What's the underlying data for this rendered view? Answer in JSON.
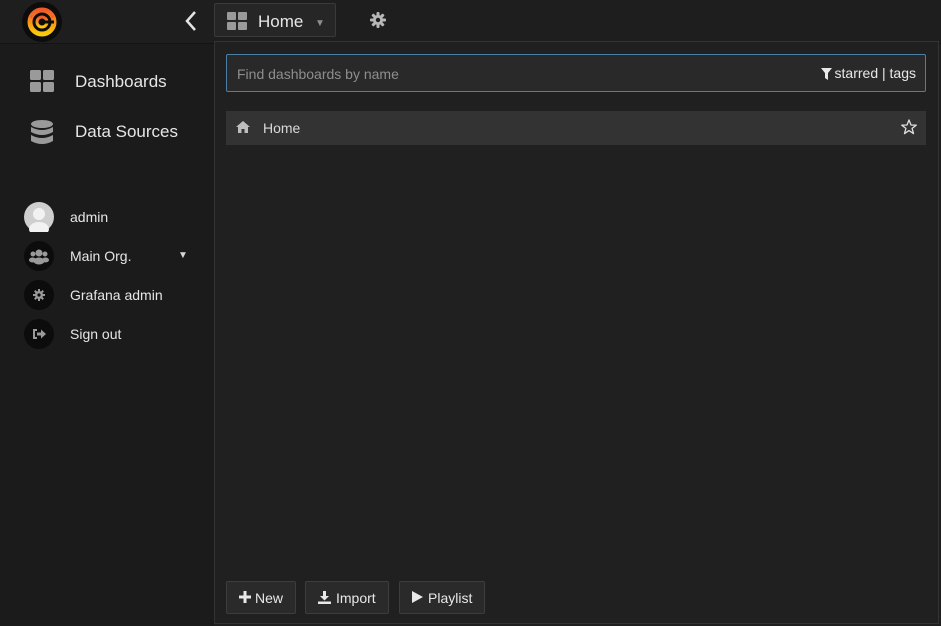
{
  "topbar": {
    "dashboard_title": "Home"
  },
  "icons": {
    "logo": "grafana-logo",
    "collapse": "chevron-left-icon",
    "dashboards": "grid-icon",
    "data_sources": "database-icon",
    "settings": "gear-icon",
    "home": "home-icon",
    "star": "star-icon",
    "filter": "filter-icon"
  },
  "sidebar": {
    "menu": [
      {
        "label": "Dashboards"
      },
      {
        "label": "Data Sources"
      }
    ],
    "user": {
      "name": "admin",
      "org": "Main Org.",
      "grafana_admin": "Grafana admin",
      "sign_out": "Sign out"
    }
  },
  "search": {
    "placeholder": "Find dashboards by name",
    "starred_label": "starred",
    "separator": "|",
    "tags_label": "tags"
  },
  "results": [
    {
      "title": "Home"
    }
  ],
  "footer": {
    "new_label": "New",
    "import_label": "Import",
    "playlist_label": "Playlist"
  },
  "colors": {
    "accent": "#4a7fa6",
    "logo_orange": "#f05a28",
    "logo_yellow": "#fbca0a"
  }
}
